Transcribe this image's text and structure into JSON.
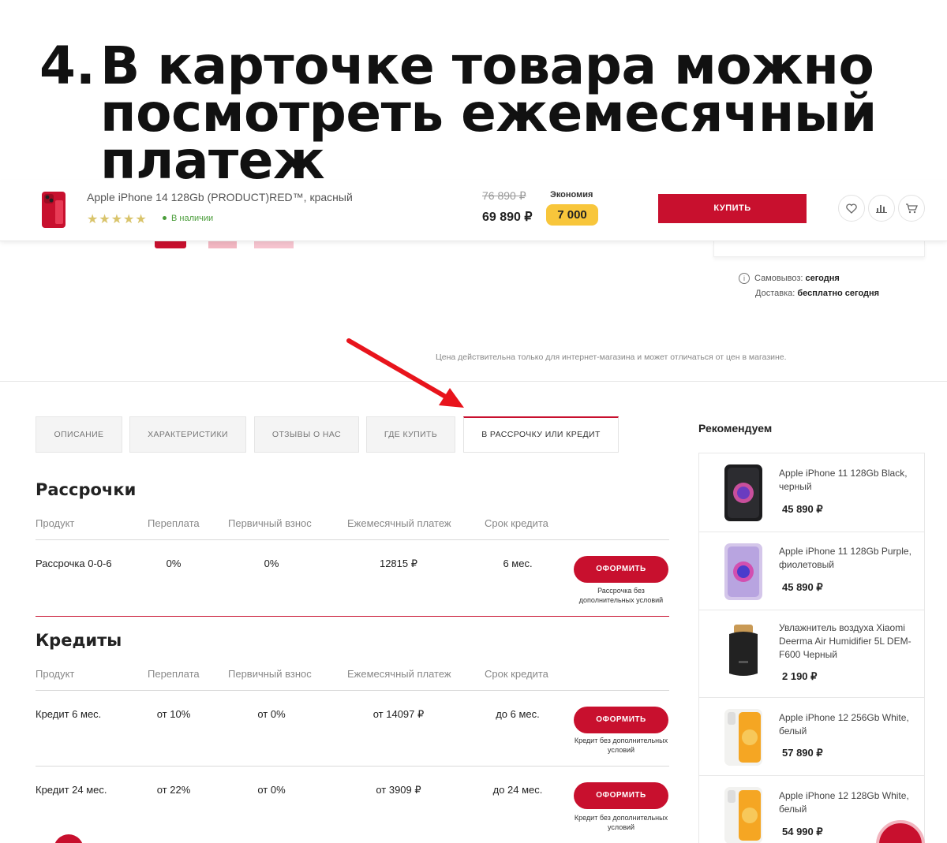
{
  "headline": {
    "number": "4.",
    "line1": "В карточке товара можно",
    "line2": "посмотреть ежемесячный",
    "line3": "платеж"
  },
  "product_bar": {
    "title": "Apple iPhone 14 128Gb (PRODUCT)RED™, красный",
    "stars": "★★★★★",
    "stock": "В наличии",
    "old_price": "76 890 ₽",
    "price": "69 890 ₽",
    "savings_label": "Экономия",
    "savings_value": "7 000",
    "buy_label": "КУПИТЬ",
    "icons": [
      "heart-icon",
      "compare-icon",
      "cart-icon"
    ]
  },
  "delivery": {
    "pickup_label": "Самовывоз:",
    "pickup_value": "сегодня",
    "delivery_label": "Доставка:",
    "delivery_value": "бесплатно сегодня",
    "price_note": "Цена действительна только для интернет-магазина и может отличаться от цен в магазине."
  },
  "tabs": [
    {
      "label": "ОПИСАНИЕ"
    },
    {
      "label": "ХАРАКТЕРИСТИКИ"
    },
    {
      "label": "ОТЗЫВЫ О НАС"
    },
    {
      "label": "ГДЕ КУПИТЬ"
    },
    {
      "label": "В РАССРОЧКУ ИЛИ КРЕДИТ",
      "active": true
    }
  ],
  "columns": [
    "Продукт",
    "Переплата",
    "Первичный взнос",
    "Ежемесячный платеж",
    "Срок кредита"
  ],
  "installments": {
    "title": "Рассрочки",
    "rows": [
      {
        "product": "Рассрочка 0-0-6",
        "overpay": "0%",
        "down": "0%",
        "monthly": "12815  ₽",
        "term": "6 мес.",
        "button": "ОФОРМИТЬ",
        "note": "Рассрочка без дополнительных условий"
      }
    ]
  },
  "credits": {
    "title": "Кредиты",
    "rows": [
      {
        "product": "Кредит 6 мес.",
        "overpay": "от 10%",
        "down": "от 0%",
        "monthly": "от 14097  ₽",
        "term": "до 6 мес.",
        "button": "ОФОРМИТЬ",
        "note": "Кредит без дополнительных условий"
      },
      {
        "product": "Кредит 24 мес.",
        "overpay": "от 22%",
        "down": "от 0%",
        "monthly": "от 3909  ₽",
        "term": "до 24 мес.",
        "button": "ОФОРМИТЬ",
        "note": "Кредит без дополнительных условий"
      }
    ]
  },
  "recommend": {
    "title": "Рекомендуем",
    "items": [
      {
        "name": "Apple iPhone 11 128Gb Black, черный",
        "price": "45 890 ₽",
        "color": "#1c1c1e"
      },
      {
        "name": "Apple iPhone 11 128Gb Purple, фиолетовый",
        "price": "45 890 ₽",
        "color": "#d4c6ea"
      },
      {
        "name": "Увлажнитель воздуха Xiaomi Deerma Air Humidifier 5L DEM-F600 Черный",
        "price": "2 190 ₽",
        "color": "#222222"
      },
      {
        "name": "Apple iPhone 12 256Gb White, белый",
        "price": "57 890 ₽",
        "color": "#f2f2f0"
      },
      {
        "name": "Apple iPhone 12 128Gb White, белый",
        "price": "54 990 ₽",
        "color": "#f2f2f0"
      }
    ]
  },
  "colors": {
    "accent": "#c8102e",
    "savings_badge": "#f8c63b",
    "stock": "#4a9d3a",
    "arrow": "#e8141c"
  }
}
